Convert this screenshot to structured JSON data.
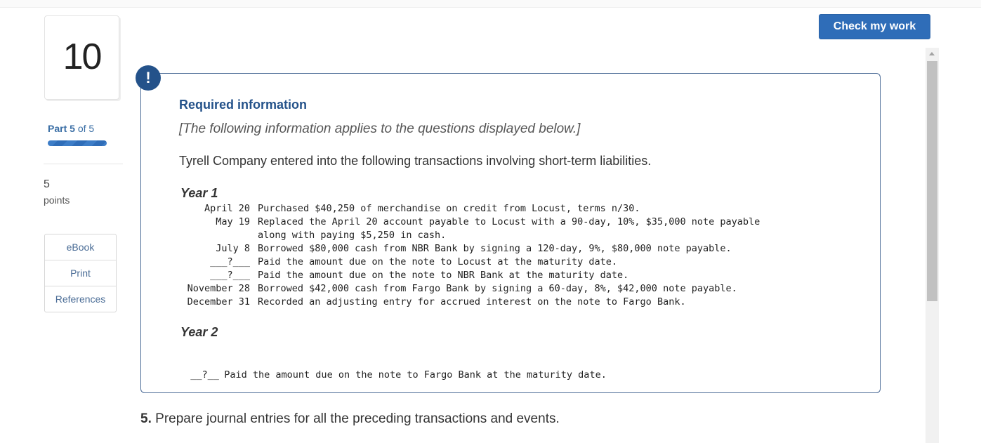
{
  "question": {
    "number": "10",
    "part_label": "Part",
    "part_current": "5",
    "part_of": "of 5",
    "points_value": "5",
    "points_label": "points"
  },
  "sidebar": {
    "buttons": [
      "eBook",
      "Print",
      "References"
    ]
  },
  "header": {
    "check_button": "Check my work"
  },
  "info": {
    "alert_symbol": "!",
    "title": "Required information",
    "note": "[The following information applies to the questions displayed below.]",
    "intro": "Tyrell Company entered into the following transactions involving short-term liabilities.",
    "year1_label": "Year 1",
    "year1_rows": [
      {
        "date": "April 20",
        "text": "Purchased $40,250 of merchandise on credit from Locust, terms n/30."
      },
      {
        "date": "May 19",
        "text": "Replaced the April 20 account payable to Locust with a 90-day, 10%, $35,000 note payable"
      },
      {
        "date": "",
        "text": "along with paying $5,250 in cash."
      },
      {
        "date": "July 8",
        "text": "Borrowed $80,000 cash from NBR Bank by signing a 120-day, 9%, $80,000 note payable."
      },
      {
        "date": "___?___",
        "text": "Paid the amount due on the note to Locust at the maturity date."
      },
      {
        "date": "___?___",
        "text": "Paid the amount due on the note to NBR Bank at the maturity date."
      },
      {
        "date": "November 28",
        "text": "Borrowed $42,000 cash from Fargo Bank by signing a 60-day, 8%, $42,000 note payable."
      },
      {
        "date": "December 31",
        "text": "Recorded an adjusting entry for accrued interest on the note to Fargo Bank."
      }
    ],
    "year2_label": "Year 2",
    "year2_rows": [
      {
        "date": "__?__",
        "text": "Paid the amount due on the note to Fargo Bank at the maturity date."
      }
    ]
  },
  "prompt": {
    "number": "5.",
    "text": "Prepare journal entries for all the preceding transactions and events."
  }
}
